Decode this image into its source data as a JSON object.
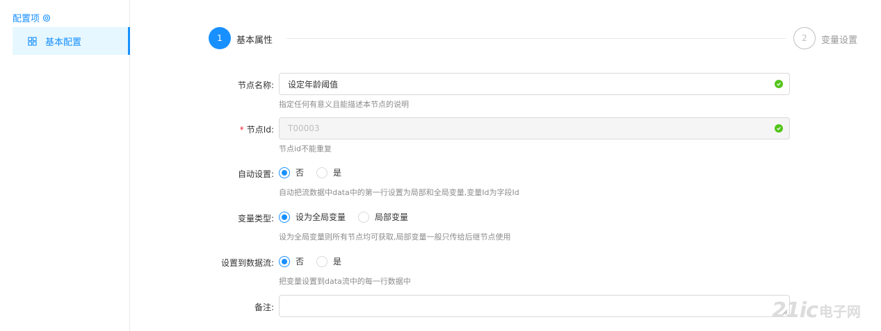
{
  "sidebar": {
    "header": "配置项",
    "header_icon": "gear-icon",
    "items": [
      {
        "label": "基本配置",
        "icon": "grid-icon",
        "active": true
      }
    ]
  },
  "steps": [
    {
      "number": "1",
      "label": "基本属性",
      "active": true
    },
    {
      "number": "2",
      "label": "变量设置",
      "active": false
    }
  ],
  "form": {
    "node_name": {
      "label": "节点名称:",
      "value": "设定年龄阈值",
      "help": "指定任何有意义且能描述本节点的说明"
    },
    "node_id": {
      "required_mark": "*",
      "label": "节点Id:",
      "value": "T00003",
      "help": "节点id不能重复"
    },
    "auto_setting": {
      "label": "自动设置:",
      "options": [
        "否",
        "是"
      ],
      "selected": "否",
      "help": "自动把流数据中data中的第一行设置为局部和全局变量,变量Id为字段Id"
    },
    "var_type": {
      "label": "变量类型:",
      "options": [
        "设为全局变量",
        "局部变量"
      ],
      "selected": "设为全局变量",
      "help": "设为全局变量则所有节点均可获取,局部变量一般只传给后继节点使用"
    },
    "to_dataflow": {
      "label": "设置到数据流:",
      "options": [
        "否",
        "是"
      ],
      "selected": "否",
      "help": "把变量设置到data流中的每一行数据中"
    },
    "remark": {
      "label": "备注:",
      "value": ""
    }
  },
  "watermark": {
    "brand": "21ic",
    "text": "电子网"
  },
  "colors": {
    "primary": "#1890ff",
    "success": "#52c41a",
    "required": "#f5222d",
    "help_text": "#8c8c8c"
  }
}
